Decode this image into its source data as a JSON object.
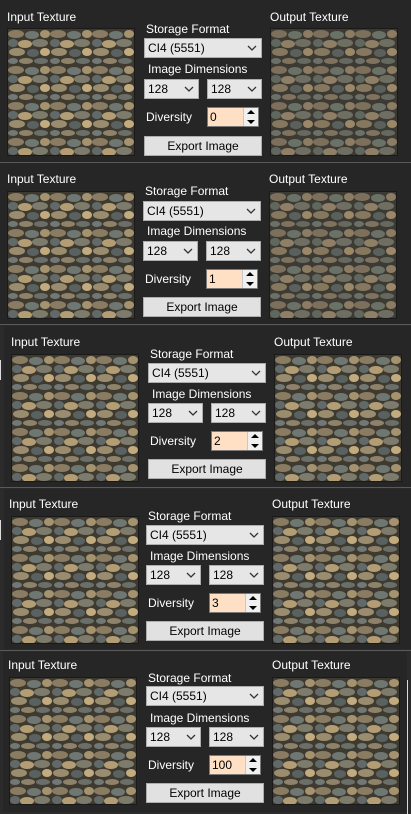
{
  "panels": [
    {
      "input_label": "Input Texture",
      "output_label": "Output Texture",
      "storage_label": "Storage Format",
      "storage_value": "CI4 (5551)",
      "dimensions_label": "Image Dimensions",
      "width_value": "128",
      "height_value": "128",
      "diversity_label": "Diversity",
      "diversity_value": "0",
      "export_label": "Export Image"
    },
    {
      "input_label": "Input Texture",
      "output_label": "Output Texture",
      "storage_label": "Storage Format",
      "storage_value": "CI4 (5551)",
      "dimensions_label": "Image Dimensions",
      "width_value": "128",
      "height_value": "128",
      "diversity_label": "Diversity",
      "diversity_value": "1",
      "export_label": "Export Image"
    },
    {
      "input_label": "Input Texture",
      "output_label": "Output Texture",
      "storage_label": "Storage Format",
      "storage_value": "CI4 (5551)",
      "dimensions_label": "Image Dimensions",
      "width_value": "128",
      "height_value": "128",
      "diversity_label": "Diversity",
      "diversity_value": "2",
      "export_label": "Export Image"
    },
    {
      "input_label": "Input Texture",
      "output_label": "Output Texture",
      "storage_label": "Storage Format",
      "storage_value": "CI4 (5551)",
      "dimensions_label": "Image Dimensions",
      "width_value": "128",
      "height_value": "128",
      "diversity_label": "Diversity",
      "diversity_value": "3",
      "export_label": "Export Image"
    },
    {
      "input_label": "Input Texture",
      "output_label": "Output Texture",
      "storage_label": "Storage Format",
      "storage_value": "CI4 (5551)",
      "dimensions_label": "Image Dimensions",
      "width_value": "128",
      "height_value": "128",
      "diversity_label": "Diversity",
      "diversity_value": "100",
      "export_label": "Export Image"
    }
  ]
}
